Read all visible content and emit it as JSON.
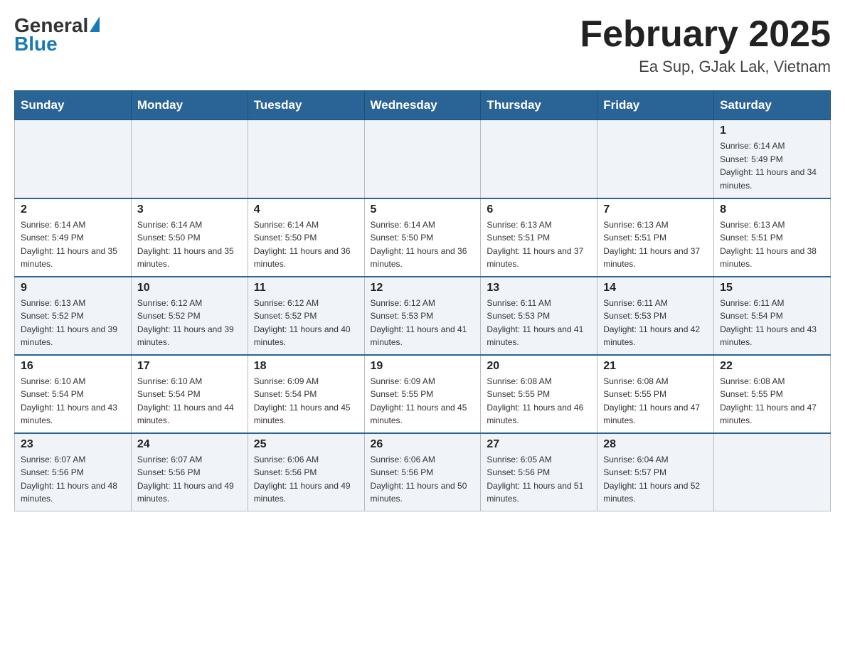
{
  "header": {
    "logo_general": "General",
    "logo_blue": "Blue",
    "month_title": "February 2025",
    "location": "Ea Sup, GJak Lak, Vietnam"
  },
  "weekdays": [
    "Sunday",
    "Monday",
    "Tuesday",
    "Wednesday",
    "Thursday",
    "Friday",
    "Saturday"
  ],
  "weeks": [
    [
      {
        "day": "",
        "sunrise": "",
        "sunset": "",
        "daylight": ""
      },
      {
        "day": "",
        "sunrise": "",
        "sunset": "",
        "daylight": ""
      },
      {
        "day": "",
        "sunrise": "",
        "sunset": "",
        "daylight": ""
      },
      {
        "day": "",
        "sunrise": "",
        "sunset": "",
        "daylight": ""
      },
      {
        "day": "",
        "sunrise": "",
        "sunset": "",
        "daylight": ""
      },
      {
        "day": "",
        "sunrise": "",
        "sunset": "",
        "daylight": ""
      },
      {
        "day": "1",
        "sunrise": "Sunrise: 6:14 AM",
        "sunset": "Sunset: 5:49 PM",
        "daylight": "Daylight: 11 hours and 34 minutes."
      }
    ],
    [
      {
        "day": "2",
        "sunrise": "Sunrise: 6:14 AM",
        "sunset": "Sunset: 5:49 PM",
        "daylight": "Daylight: 11 hours and 35 minutes."
      },
      {
        "day": "3",
        "sunrise": "Sunrise: 6:14 AM",
        "sunset": "Sunset: 5:50 PM",
        "daylight": "Daylight: 11 hours and 35 minutes."
      },
      {
        "day": "4",
        "sunrise": "Sunrise: 6:14 AM",
        "sunset": "Sunset: 5:50 PM",
        "daylight": "Daylight: 11 hours and 36 minutes."
      },
      {
        "day": "5",
        "sunrise": "Sunrise: 6:14 AM",
        "sunset": "Sunset: 5:50 PM",
        "daylight": "Daylight: 11 hours and 36 minutes."
      },
      {
        "day": "6",
        "sunrise": "Sunrise: 6:13 AM",
        "sunset": "Sunset: 5:51 PM",
        "daylight": "Daylight: 11 hours and 37 minutes."
      },
      {
        "day": "7",
        "sunrise": "Sunrise: 6:13 AM",
        "sunset": "Sunset: 5:51 PM",
        "daylight": "Daylight: 11 hours and 37 minutes."
      },
      {
        "day": "8",
        "sunrise": "Sunrise: 6:13 AM",
        "sunset": "Sunset: 5:51 PM",
        "daylight": "Daylight: 11 hours and 38 minutes."
      }
    ],
    [
      {
        "day": "9",
        "sunrise": "Sunrise: 6:13 AM",
        "sunset": "Sunset: 5:52 PM",
        "daylight": "Daylight: 11 hours and 39 minutes."
      },
      {
        "day": "10",
        "sunrise": "Sunrise: 6:12 AM",
        "sunset": "Sunset: 5:52 PM",
        "daylight": "Daylight: 11 hours and 39 minutes."
      },
      {
        "day": "11",
        "sunrise": "Sunrise: 6:12 AM",
        "sunset": "Sunset: 5:52 PM",
        "daylight": "Daylight: 11 hours and 40 minutes."
      },
      {
        "day": "12",
        "sunrise": "Sunrise: 6:12 AM",
        "sunset": "Sunset: 5:53 PM",
        "daylight": "Daylight: 11 hours and 41 minutes."
      },
      {
        "day": "13",
        "sunrise": "Sunrise: 6:11 AM",
        "sunset": "Sunset: 5:53 PM",
        "daylight": "Daylight: 11 hours and 41 minutes."
      },
      {
        "day": "14",
        "sunrise": "Sunrise: 6:11 AM",
        "sunset": "Sunset: 5:53 PM",
        "daylight": "Daylight: 11 hours and 42 minutes."
      },
      {
        "day": "15",
        "sunrise": "Sunrise: 6:11 AM",
        "sunset": "Sunset: 5:54 PM",
        "daylight": "Daylight: 11 hours and 43 minutes."
      }
    ],
    [
      {
        "day": "16",
        "sunrise": "Sunrise: 6:10 AM",
        "sunset": "Sunset: 5:54 PM",
        "daylight": "Daylight: 11 hours and 43 minutes."
      },
      {
        "day": "17",
        "sunrise": "Sunrise: 6:10 AM",
        "sunset": "Sunset: 5:54 PM",
        "daylight": "Daylight: 11 hours and 44 minutes."
      },
      {
        "day": "18",
        "sunrise": "Sunrise: 6:09 AM",
        "sunset": "Sunset: 5:54 PM",
        "daylight": "Daylight: 11 hours and 45 minutes."
      },
      {
        "day": "19",
        "sunrise": "Sunrise: 6:09 AM",
        "sunset": "Sunset: 5:55 PM",
        "daylight": "Daylight: 11 hours and 45 minutes."
      },
      {
        "day": "20",
        "sunrise": "Sunrise: 6:08 AM",
        "sunset": "Sunset: 5:55 PM",
        "daylight": "Daylight: 11 hours and 46 minutes."
      },
      {
        "day": "21",
        "sunrise": "Sunrise: 6:08 AM",
        "sunset": "Sunset: 5:55 PM",
        "daylight": "Daylight: 11 hours and 47 minutes."
      },
      {
        "day": "22",
        "sunrise": "Sunrise: 6:08 AM",
        "sunset": "Sunset: 5:55 PM",
        "daylight": "Daylight: 11 hours and 47 minutes."
      }
    ],
    [
      {
        "day": "23",
        "sunrise": "Sunrise: 6:07 AM",
        "sunset": "Sunset: 5:56 PM",
        "daylight": "Daylight: 11 hours and 48 minutes."
      },
      {
        "day": "24",
        "sunrise": "Sunrise: 6:07 AM",
        "sunset": "Sunset: 5:56 PM",
        "daylight": "Daylight: 11 hours and 49 minutes."
      },
      {
        "day": "25",
        "sunrise": "Sunrise: 6:06 AM",
        "sunset": "Sunset: 5:56 PM",
        "daylight": "Daylight: 11 hours and 49 minutes."
      },
      {
        "day": "26",
        "sunrise": "Sunrise: 6:06 AM",
        "sunset": "Sunset: 5:56 PM",
        "daylight": "Daylight: 11 hours and 50 minutes."
      },
      {
        "day": "27",
        "sunrise": "Sunrise: 6:05 AM",
        "sunset": "Sunset: 5:56 PM",
        "daylight": "Daylight: 11 hours and 51 minutes."
      },
      {
        "day": "28",
        "sunrise": "Sunrise: 6:04 AM",
        "sunset": "Sunset: 5:57 PM",
        "daylight": "Daylight: 11 hours and 52 minutes."
      },
      {
        "day": "",
        "sunrise": "",
        "sunset": "",
        "daylight": ""
      }
    ]
  ]
}
